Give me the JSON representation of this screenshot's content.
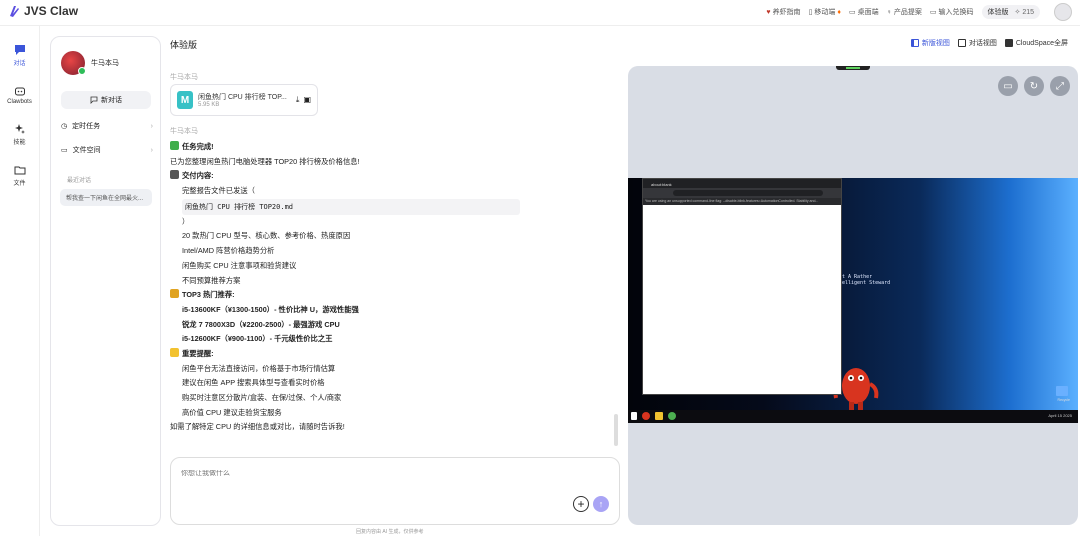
{
  "app": {
    "name": "JVS Claw"
  },
  "topbar": {
    "links": [
      "养虾指南",
      "移动端",
      "桌面端",
      "产品提案",
      "输入兑换码"
    ],
    "badge": "体验版",
    "credits": "215"
  },
  "leftnav": [
    "对话",
    "Clawbots",
    "技能",
    "文件"
  ],
  "sidebar": {
    "user_name": "牛马本马",
    "new_chat": "新对话",
    "menu": [
      "定时任务",
      "文件空间"
    ],
    "recent_heading": "最近对话",
    "recent_item": "帮我查一下闲鱼在全网最火..."
  },
  "main": {
    "title": "体验版",
    "views": [
      "新版视图",
      "对话视图",
      "CloudSpace全屏"
    ],
    "sender": "牛马本马",
    "file": {
      "name": "闲鱼热门 CPU 排行榜 TOP...",
      "size": "5.95 KB"
    },
    "message": [
      "任务完成!",
      "已为您整理闲鱼热门电脑处理器 TOP20 排行榜及价格信息!",
      "交付内容:",
      "完整报告文件已发送（",
      "闲鱼热门 CPU 排行榜 TOP20.md",
      "）",
      "20 款热门 CPU 型号、核心数、参考价格、热度原因",
      "Intel/AMD 阵营价格趋势分析",
      "闲鱼购买 CPU 注意事项和验货建议",
      "不同预算推荐方案",
      "TOP3 热门推荐:",
      "i5-13600KF（¥1300-1500）- 性价比神 U，游戏性能强",
      "锐龙 7 7800X3D（¥2200-2500）- 最强游戏 CPU",
      "i5-12600KF（¥900-1100）- 千元级性价比之王",
      "重要提醒:",
      "闲鱼平台无法直接访问，价格基于市场行情估算",
      "建议在闲鱼 APP 搜索具体型号查看实时价格",
      "购买时注意区分散片/盒装、在保/过保、个人/商家",
      "高价值 CPU 建议走验货宝服务",
      "如需了解特定 CPU 的详细信息或对比，请随时告诉我!"
    ],
    "input_placeholder": "你想让我做什么",
    "disclaimer": "回复内容由 AI 生成，仅供参考"
  },
  "preview": {
    "desktop_text": [
      "t A Rather",
      "elligent Steward"
    ],
    "browser_tab": "about:blank",
    "bookmarks": "You are using an unsupported command-line flag: --disable-blink-features=AutomationControlled. Stability and...",
    "taskbar_time": "April 15 2025",
    "recycle_label": "Recycle"
  }
}
